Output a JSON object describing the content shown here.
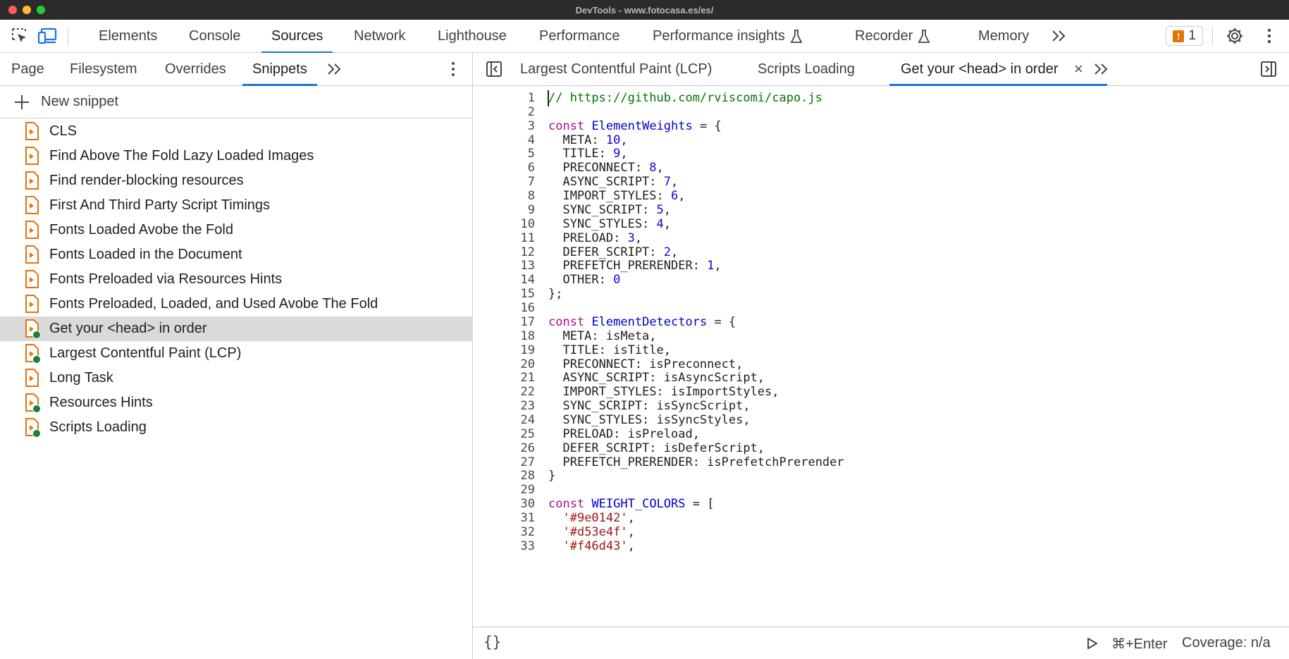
{
  "window": {
    "title": "DevTools - www.fotocasa.es/es/"
  },
  "toolbar": {
    "tabs": [
      {
        "label": "Elements"
      },
      {
        "label": "Console"
      },
      {
        "label": "Sources"
      },
      {
        "label": "Network"
      },
      {
        "label": "Lighthouse"
      },
      {
        "label": "Performance"
      },
      {
        "label": "Performance insights"
      },
      {
        "label": "Recorder"
      },
      {
        "label": "Memory"
      }
    ],
    "active_tab": "Sources",
    "issues_count": "1",
    "icons": [
      "inspect-element-icon",
      "device-toolbar-icon",
      "more-tabs-icon",
      "issues-icon",
      "settings-icon",
      "more-options-icon"
    ]
  },
  "sources": {
    "subtabs": [
      {
        "label": "Page"
      },
      {
        "label": "Filesystem"
      },
      {
        "label": "Overrides"
      },
      {
        "label": "Snippets"
      }
    ],
    "active_subtab": "Snippets",
    "new_snippet_label": "New snippet",
    "snippets": [
      {
        "name": "CLS",
        "has_run": false
      },
      {
        "name": "Find Above The Fold Lazy Loaded Images",
        "has_run": false
      },
      {
        "name": "Find render-blocking resources",
        "has_run": false
      },
      {
        "name": "First And Third Party Script Timings",
        "has_run": false
      },
      {
        "name": "Fonts Loaded Avobe the Fold",
        "has_run": false
      },
      {
        "name": "Fonts Loaded in the Document",
        "has_run": false
      },
      {
        "name": "Fonts Preloaded via Resources Hints",
        "has_run": false
      },
      {
        "name": "Fonts Preloaded, Loaded, and Used Avobe The Fold",
        "has_run": false
      },
      {
        "name": "Get your <head> in order",
        "has_run": true,
        "selected": true
      },
      {
        "name": "Largest Contentful Paint (LCP)",
        "has_run": true
      },
      {
        "name": "Long Task",
        "has_run": false
      },
      {
        "name": "Resources Hints",
        "has_run": true
      },
      {
        "name": "Scripts Loading",
        "has_run": true
      }
    ]
  },
  "editor": {
    "tabs": [
      {
        "label": "Largest Contentful Paint (LCP)"
      },
      {
        "label": "Scripts Loading"
      },
      {
        "label": "Get your <head> in order"
      }
    ],
    "active_tab": "Get your <head> in order",
    "colors": {
      "comment": "#007400",
      "keyword": "#aa0d91",
      "definition": "#0000cc",
      "number": "#1c00cf",
      "string": "#a31515"
    },
    "lines": [
      {
        "n": "1",
        "tokens": [
          [
            "comment",
            "// https://github.com/rviscomi/capo.js"
          ]
        ]
      },
      {
        "n": "2",
        "tokens": []
      },
      {
        "n": "3",
        "tokens": [
          [
            "keyword",
            "const"
          ],
          [
            "plain",
            " "
          ],
          [
            "definition",
            "ElementWeights"
          ],
          [
            "plain",
            " = {"
          ]
        ]
      },
      {
        "n": "4",
        "tokens": [
          [
            "plain",
            "  META: "
          ],
          [
            "number",
            "10"
          ],
          [
            "plain",
            ","
          ]
        ]
      },
      {
        "n": "5",
        "tokens": [
          [
            "plain",
            "  TITLE: "
          ],
          [
            "number",
            "9"
          ],
          [
            "plain",
            ","
          ]
        ]
      },
      {
        "n": "6",
        "tokens": [
          [
            "plain",
            "  PRECONNECT: "
          ],
          [
            "number",
            "8"
          ],
          [
            "plain",
            ","
          ]
        ]
      },
      {
        "n": "7",
        "tokens": [
          [
            "plain",
            "  ASYNC_SCRIPT: "
          ],
          [
            "number",
            "7"
          ],
          [
            "plain",
            ","
          ]
        ]
      },
      {
        "n": "8",
        "tokens": [
          [
            "plain",
            "  IMPORT_STYLES: "
          ],
          [
            "number",
            "6"
          ],
          [
            "plain",
            ","
          ]
        ]
      },
      {
        "n": "9",
        "tokens": [
          [
            "plain",
            "  SYNC_SCRIPT: "
          ],
          [
            "number",
            "5"
          ],
          [
            "plain",
            ","
          ]
        ]
      },
      {
        "n": "10",
        "tokens": [
          [
            "plain",
            "  SYNC_STYLES: "
          ],
          [
            "number",
            "4"
          ],
          [
            "plain",
            ","
          ]
        ]
      },
      {
        "n": "11",
        "tokens": [
          [
            "plain",
            "  PRELOAD: "
          ],
          [
            "number",
            "3"
          ],
          [
            "plain",
            ","
          ]
        ]
      },
      {
        "n": "12",
        "tokens": [
          [
            "plain",
            "  DEFER_SCRIPT: "
          ],
          [
            "number",
            "2"
          ],
          [
            "plain",
            ","
          ]
        ]
      },
      {
        "n": "13",
        "tokens": [
          [
            "plain",
            "  PREFETCH_PRERENDER: "
          ],
          [
            "number",
            "1"
          ],
          [
            "plain",
            ","
          ]
        ]
      },
      {
        "n": "14",
        "tokens": [
          [
            "plain",
            "  OTHER: "
          ],
          [
            "number",
            "0"
          ]
        ]
      },
      {
        "n": "15",
        "tokens": [
          [
            "plain",
            "};"
          ]
        ]
      },
      {
        "n": "16",
        "tokens": []
      },
      {
        "n": "17",
        "tokens": [
          [
            "keyword",
            "const"
          ],
          [
            "plain",
            " "
          ],
          [
            "definition",
            "ElementDetectors"
          ],
          [
            "plain",
            " = {"
          ]
        ]
      },
      {
        "n": "18",
        "tokens": [
          [
            "plain",
            "  META: isMeta,"
          ]
        ]
      },
      {
        "n": "19",
        "tokens": [
          [
            "plain",
            "  TITLE: isTitle,"
          ]
        ]
      },
      {
        "n": "20",
        "tokens": [
          [
            "plain",
            "  PRECONNECT: isPreconnect,"
          ]
        ]
      },
      {
        "n": "21",
        "tokens": [
          [
            "plain",
            "  ASYNC_SCRIPT: isAsyncScript,"
          ]
        ]
      },
      {
        "n": "22",
        "tokens": [
          [
            "plain",
            "  IMPORT_STYLES: isImportStyles,"
          ]
        ]
      },
      {
        "n": "23",
        "tokens": [
          [
            "plain",
            "  SYNC_SCRIPT: isSyncScript,"
          ]
        ]
      },
      {
        "n": "24",
        "tokens": [
          [
            "plain",
            "  SYNC_STYLES: isSyncStyles,"
          ]
        ]
      },
      {
        "n": "25",
        "tokens": [
          [
            "plain",
            "  PRELOAD: isPreload,"
          ]
        ]
      },
      {
        "n": "26",
        "tokens": [
          [
            "plain",
            "  DEFER_SCRIPT: isDeferScript,"
          ]
        ]
      },
      {
        "n": "27",
        "tokens": [
          [
            "plain",
            "  PREFETCH_PRERENDER: isPrefetchPrerender"
          ]
        ]
      },
      {
        "n": "28",
        "tokens": [
          [
            "plain",
            "}"
          ]
        ]
      },
      {
        "n": "29",
        "tokens": []
      },
      {
        "n": "30",
        "tokens": [
          [
            "keyword",
            "const"
          ],
          [
            "plain",
            " "
          ],
          [
            "definition",
            "WEIGHT_COLORS"
          ],
          [
            "plain",
            " = ["
          ]
        ]
      },
      {
        "n": "31",
        "tokens": [
          [
            "plain",
            "  "
          ],
          [
            "string",
            "'#9e0142'"
          ],
          [
            "plain",
            ","
          ]
        ]
      },
      {
        "n": "32",
        "tokens": [
          [
            "plain",
            "  "
          ],
          [
            "string",
            "'#d53e4f'"
          ],
          [
            "plain",
            ","
          ]
        ]
      },
      {
        "n": "33",
        "tokens": [
          [
            "plain",
            "  "
          ],
          [
            "string",
            "'#f46d43'"
          ],
          [
            "plain",
            ","
          ]
        ]
      }
    ]
  },
  "statusbar": {
    "run_shortcut": "⌘+Enter",
    "coverage": "Coverage: n/a"
  }
}
